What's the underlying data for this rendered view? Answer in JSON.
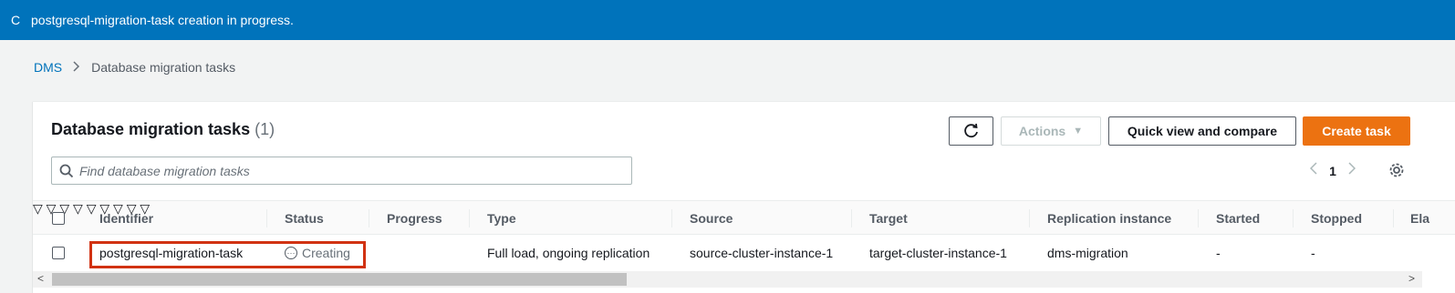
{
  "flash": {
    "message": "postgresql-migration-task creation in progress.",
    "icon": "spinner-icon"
  },
  "breadcrumb": {
    "root": "DMS",
    "current": "Database migration tasks"
  },
  "panel": {
    "title": "Database migration tasks",
    "count": "(1)",
    "buttons": {
      "actions": "Actions",
      "quick_view": "Quick view and compare",
      "create": "Create task"
    },
    "search_placeholder": "Find database migration tasks",
    "page": "1"
  },
  "columns": [
    "Identifier",
    "Status",
    "Progress",
    "Type",
    "Source",
    "Target",
    "Replication instance",
    "Started",
    "Stopped",
    "Ela"
  ],
  "rows": [
    {
      "identifier": "postgresql-migration-task",
      "status": "Creating",
      "progress": "",
      "type": "Full load, ongoing replication",
      "source": "source-cluster-instance-1",
      "target": "target-cluster-instance-1",
      "replication_instance": "dms-migration",
      "started": "-",
      "stopped": "-"
    }
  ],
  "colors": {
    "flash_bg": "#0073bb",
    "primary": "#ec7211",
    "highlight": "#d13212",
    "link": "#0073bb"
  }
}
